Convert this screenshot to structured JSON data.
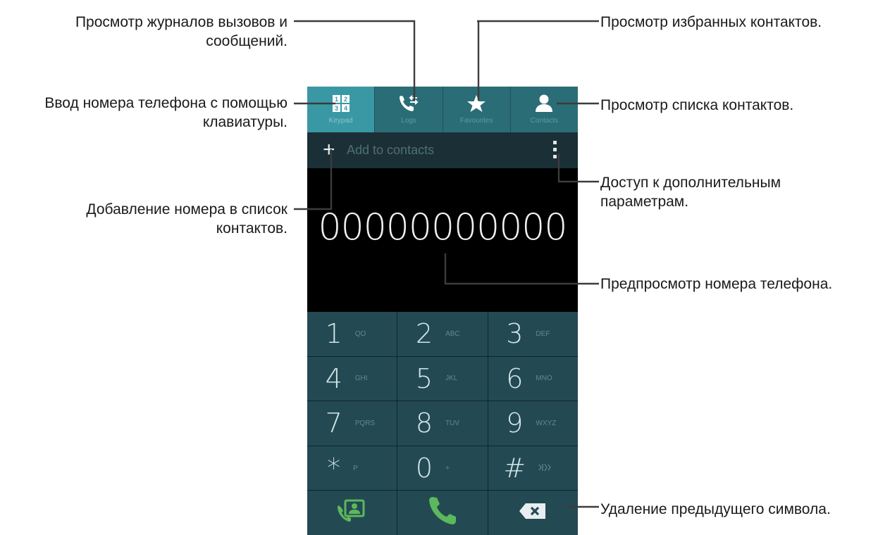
{
  "annotations": {
    "logs": [
      "Просмотр журналов вызовов и",
      "сообщений."
    ],
    "favourites": [
      "Просмотр избранных контактов."
    ],
    "keypad": [
      "Ввод номера телефона с помощью",
      "клавиатуры."
    ],
    "contacts": [
      "Просмотр списка контактов."
    ],
    "add": [
      "Добавление номера в список",
      "контактов."
    ],
    "more": [
      "Доступ к дополнительным",
      "параметрам."
    ],
    "preview": [
      "Предпросмотр номера телефона."
    ],
    "delete": [
      "Удаление предыдущего символа."
    ]
  },
  "tabs": [
    {
      "label": "Keypad",
      "icon": "keypad-icon",
      "active": true
    },
    {
      "label": "Logs",
      "icon": "call-logs-icon",
      "active": false
    },
    {
      "label": "Favourites",
      "icon": "star-icon",
      "active": false
    },
    {
      "label": "Contacts",
      "icon": "person-icon",
      "active": false
    }
  ],
  "actionbar": {
    "add_label": "Add to contacts",
    "plus": "+"
  },
  "dialed_number": "00000000000",
  "keys": [
    {
      "digit": "1",
      "letters": "QO"
    },
    {
      "digit": "2",
      "letters": "ABC"
    },
    {
      "digit": "3",
      "letters": "DEF"
    },
    {
      "digit": "4",
      "letters": "GHI"
    },
    {
      "digit": "5",
      "letters": "JKL"
    },
    {
      "digit": "6",
      "letters": "MNO"
    },
    {
      "digit": "7",
      "letters": "PQRS"
    },
    {
      "digit": "8",
      "letters": "TUV"
    },
    {
      "digit": "9",
      "letters": "WXYZ"
    },
    {
      "digit": "*",
      "letters": "P"
    },
    {
      "digit": "0",
      "letters": "+"
    },
    {
      "digit": "#",
      "letters": ""
    }
  ],
  "bottom_actions": [
    "contact-card-icon",
    "phone-call-icon",
    "backspace-icon"
  ],
  "colors": {
    "accent": "#3a98a4",
    "call_green": "#5cb85c",
    "key_bg": "#234a53"
  }
}
